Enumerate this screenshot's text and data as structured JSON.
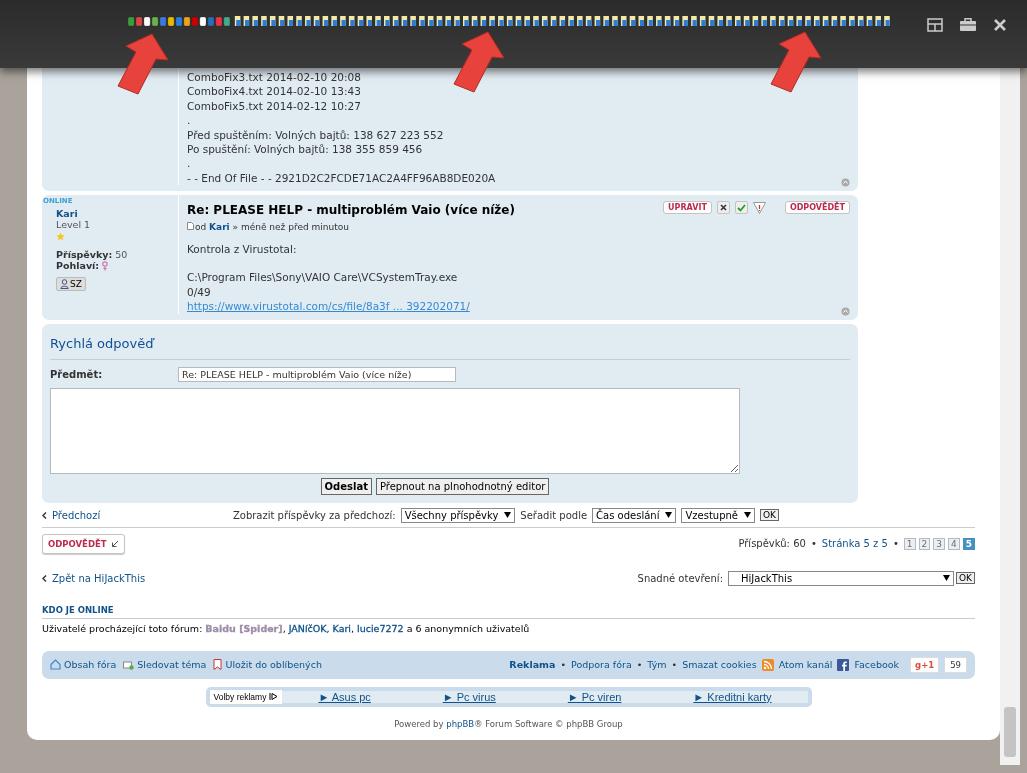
{
  "posts": [
    {
      "paragraphs": [
        [
          "ComboFix3.txt 2014-02-10 20:08",
          "ComboFix4.txt 2014-02-10 13:43",
          "ComboFix5.txt 2014-02-12 10:27",
          ".",
          "Před spuštěním: Volných bajtů: 138 627 223 552",
          "Po spuštění: Volných bajtů: 138 355 859 456",
          ".",
          "- - End Of File - - 2921D2C2FCDE71AC2A4FF96AB8DE020A"
        ]
      ]
    },
    {
      "author": {
        "online_label": "ONLINE",
        "name": "Kari",
        "rank": "Level 1",
        "posts_label": "Příspěvky:",
        "posts": "50",
        "gender_label": "Pohlaví:",
        "contact": "SZ"
      },
      "title": "Re: PLEASE HELP - multiproblém Vaio (více níže)",
      "meta_by": "od",
      "meta_author": "Kari",
      "meta_time": "» méně než před minutou",
      "actions": [
        {
          "kind": "edit",
          "label": "UPRAVIT"
        },
        {
          "kind": "delete"
        },
        {
          "kind": "approve"
        },
        {
          "kind": "report"
        },
        {
          "kind": "quote",
          "label": "ODPOVĚDĚT"
        }
      ],
      "paragraphs": [
        [
          "Kontrola z Virustotal:"
        ],
        [
          "C:\\Program Files\\Sony\\VAIO Care\\VCSystemTray.exe",
          "0/49"
        ]
      ],
      "link": "https://www.virustotal.com/cs/file/8a3f ... 392202071/"
    }
  ],
  "quick_reply": {
    "title": "Rychlá odpověď",
    "subject_label": "Předmět:",
    "subject_value": "Re: PLEASE HELP - multiproblém Vaio (více níže)",
    "submit": "Odeslat",
    "editor": "Přepnout na plnohodnotný editor"
  },
  "display": {
    "previous_link": "Předchozí",
    "show_label": "Zobrazit příspěvky za předchozí:",
    "show_value": "Všechny příspěvky",
    "sort_label": "Seřadit podle",
    "sort_value": "Čas odeslání",
    "order_value": "Vzestupně",
    "go": "OK"
  },
  "pagination": {
    "reply_button": "ODPOVĚDĚT",
    "count": "Příspěvků: 60",
    "separator": "•",
    "page_label": "Stránka 5 z 5",
    "pages": [
      {
        "label": "1",
        "selected": false
      },
      {
        "label": "2",
        "selected": false
      },
      {
        "label": "3",
        "selected": false
      },
      {
        "label": "4",
        "selected": false
      },
      {
        "label": "5",
        "selected": true
      }
    ]
  },
  "jump": {
    "back_link": "Zpět na HiJackThis",
    "label": "Snadné otevření:",
    "value": "HiJackThis",
    "go": "OK"
  },
  "online": {
    "heading": "KDO JE ONLINE",
    "prefix": "Uživatelé procházející toto fórum:",
    "separator": ",",
    "users": [
      {
        "name": "Baidu [Spider]",
        "color": "#9e8da7"
      },
      {
        "name": "JANíčOK",
        "color": "#105289"
      },
      {
        "name": "Kari",
        "color": "#105289"
      },
      {
        "name": "lucie7272",
        "color": "#105289"
      }
    ],
    "suffix": "a 6 anonymních uživatelů"
  },
  "navbar": {
    "left": [
      {
        "kind": "home",
        "label": "Obsah fóra"
      },
      {
        "kind": "watch",
        "label": "Sledovat téma"
      },
      {
        "kind": "bookmark",
        "label": "Uložit do oblíbených"
      }
    ],
    "separator": "•",
    "right": [
      {
        "kind": "bold",
        "label": "Reklama"
      },
      {
        "kind": "plain",
        "label": "Podpora fóra"
      },
      {
        "kind": "plain",
        "label": "Tým"
      },
      {
        "kind": "plain",
        "label": "Smazat cookies"
      },
      {
        "kind": "feed",
        "label": "Atom kanál"
      },
      {
        "kind": "facebook",
        "label": "Facebook"
      }
    ],
    "plusone": {
      "label": "g+1",
      "count": "59"
    }
  },
  "ads": {
    "choices_label": "Volby reklamy",
    "links": [
      "► Asus pc",
      "► Pc virus",
      "► Pc viren",
      "► Kreditni karty"
    ]
  },
  "powered": {
    "prefix": "Powered by",
    "link": "phpBB",
    "suffix": "® Forum Software © phpBB Group"
  }
}
